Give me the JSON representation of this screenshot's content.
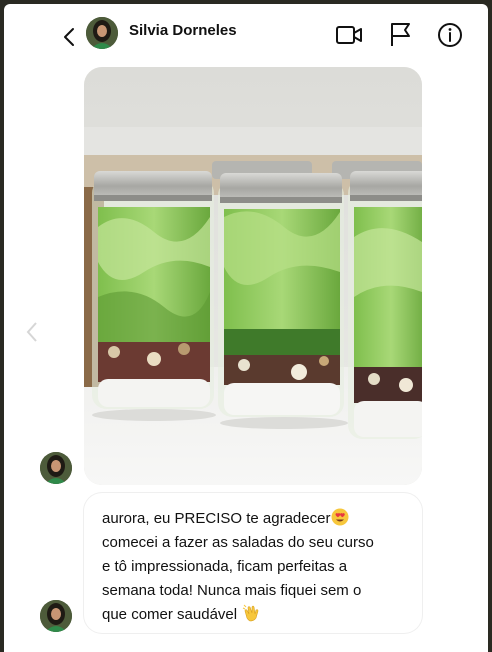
{
  "header": {
    "contact_name": "Silvia Dorneles",
    "icons": [
      "back-chevron-icon",
      "video-call-icon",
      "flag-icon",
      "info-icon"
    ]
  },
  "message": {
    "lines": [
      "aurora, eu PRECISO te agradecer",
      "comecei a fazer as saladas do seu curso",
      "e tô impressionada, ficam perfeitas a",
      "semana toda! Nunca mais fiquei sem o",
      "que comer saudável"
    ],
    "emoji_1": "smiling-face-with-heart-eyes",
    "emoji_2": "clapping-hands"
  },
  "colors": {
    "text": "#111111",
    "lettuce": "#8ec95a",
    "lid": "#b8b8b4"
  }
}
